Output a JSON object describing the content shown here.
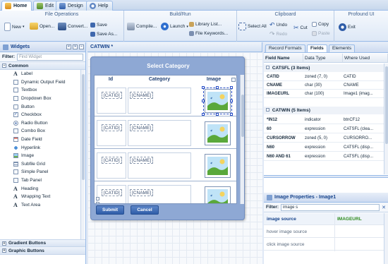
{
  "top_tabs": [
    {
      "label": "Home",
      "icon": "home-icon"
    },
    {
      "label": "Edit",
      "icon": "edit-icon"
    },
    {
      "label": "Design",
      "icon": "design-icon"
    },
    {
      "label": "Help",
      "icon": "help-icon"
    }
  ],
  "ribbon": {
    "file_operations": {
      "title": "File Operations",
      "new": "New",
      "open": "Open...",
      "convert": "Convert...",
      "save": "Save",
      "save_as": "Save As..."
    },
    "build_run": {
      "title": "Build/Run",
      "compile": "Compile...",
      "launch": "Launch",
      "library_list": "Library List...",
      "file_keywords": "File Keywords..."
    },
    "clipboard": {
      "title": "Clipboard",
      "select_all": "Select All",
      "undo": "Undo",
      "redo": "Redo",
      "cut": "Cut",
      "copy": "Copy",
      "paste": "Paste"
    },
    "profound_ui": {
      "title": "Profound UI",
      "exit": "Exit"
    }
  },
  "widgets_panel": {
    "title": "Widgets",
    "filter_label": "Filter:",
    "filter_placeholder": "Find Widget",
    "common_label": "Common",
    "items": [
      "Label",
      "Dynamic Output Field",
      "Textbox",
      "Dropdown Box",
      "Button",
      "Checkbox",
      "Radio Button",
      "Combo Box",
      "Date Field",
      "Hyperlink",
      "Image",
      "Subfile Grid",
      "Simple Panel",
      "Tab Panel",
      "Heading",
      "Wrapping Text",
      "Text Area"
    ],
    "gradient_buttons": "Gradient Buttons",
    "graphic_buttons": "Graphic Buttons"
  },
  "canvas": {
    "tab_label": "CATWIN *",
    "dialog_title": "Select Category",
    "grid_headers": {
      "id": "Id",
      "category": "Category",
      "image": "Image"
    },
    "rows": [
      {
        "id": "[CATID]",
        "category": "[CNAME]"
      },
      {
        "id": "[CATID]",
        "category": "[CNAME]"
      },
      {
        "id": "[CATID]",
        "category": "[CNAME]"
      },
      {
        "id": "[CATID]",
        "category": "[CNAME]"
      }
    ],
    "submit": "Submit",
    "cancel": "Cancel"
  },
  "right_panel": {
    "tabs": [
      "Record Formats",
      "Fields",
      "Elements"
    ],
    "columns": [
      "Field Name",
      "Data Type",
      "Where Used"
    ],
    "groups": [
      {
        "title": "CATSFL (3 Items)",
        "rows": [
          [
            "CATID",
            "zoned (7, 0)",
            "CATID"
          ],
          [
            "CNAME",
            "char (30)",
            "CNAME"
          ],
          [
            "IMAGEURL",
            "char (100)",
            "Image1 (imag..."
          ]
        ]
      },
      {
        "title": "CATWIN (5 Items)",
        "rows": [
          [
            "*IN12",
            "indicator",
            "btnCF12"
          ],
          [
            "60",
            "expression",
            "CATSFL (clea..."
          ],
          [
            "CURSORROW",
            "zoned (5, 0)",
            "CURSORRO..."
          ],
          [
            "N60",
            "expression",
            "CATSFL (disp..."
          ],
          [
            "N60 AND 61",
            "expression",
            "CATSFL (disp..."
          ]
        ]
      }
    ],
    "image_properties": {
      "title": "Image Properties - Image1",
      "filter_label": "Filter:",
      "filter_value": "image s",
      "rows": [
        {
          "name": "image source",
          "value": "IMAGEURL"
        },
        {
          "name": "hover image source",
          "value": ""
        },
        {
          "name": "click image source",
          "value": ""
        }
      ]
    }
  },
  "colors": {
    "accent": "#15428b",
    "header_blue": "#8ea8d4",
    "bound_green": "#2e8b1e"
  }
}
